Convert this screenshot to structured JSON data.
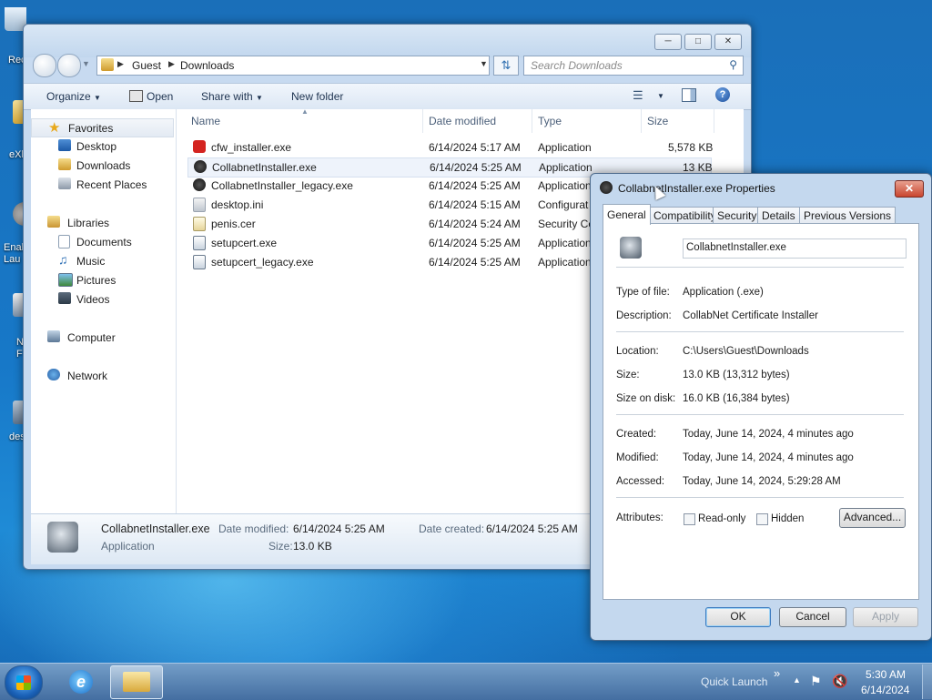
{
  "desktop": {
    "icons": [
      "Rec",
      "eXl",
      "Enal\nLau",
      "N\nF",
      "des"
    ]
  },
  "explorer": {
    "breadcrumb": [
      "Guest",
      "Downloads"
    ],
    "search_placeholder": "Search Downloads",
    "toolbar": {
      "organize": "Organize",
      "open": "Open",
      "share_with": "Share with",
      "new_folder": "New folder"
    },
    "nav": {
      "favorites": "Favorites",
      "favorites_items": [
        "Desktop",
        "Downloads",
        "Recent Places"
      ],
      "libraries": "Libraries",
      "libraries_items": [
        "Documents",
        "Music",
        "Pictures",
        "Videos"
      ],
      "computer": "Computer",
      "network": "Network"
    },
    "columns": [
      "Name",
      "Date modified",
      "Type",
      "Size"
    ],
    "files": [
      {
        "name": "cfw_installer.exe",
        "date": "6/14/2024 5:17 AM",
        "type": "Application",
        "size": "5,578 KB"
      },
      {
        "name": "CollabnetInstaller.exe",
        "date": "6/14/2024 5:25 AM",
        "type": "Application",
        "size": "13 KB"
      },
      {
        "name": "CollabnetInstaller_legacy.exe",
        "date": "6/14/2024 5:25 AM",
        "type": "Application",
        "size": ""
      },
      {
        "name": "desktop.ini",
        "date": "6/14/2024 5:15 AM",
        "type": "Configurat",
        "size": ""
      },
      {
        "name": "penis.cer",
        "date": "6/14/2024 5:24 AM",
        "type": "Security Ce",
        "size": ""
      },
      {
        "name": "setupcert.exe",
        "date": "6/14/2024 5:25 AM",
        "type": "Application",
        "size": ""
      },
      {
        "name": "setupcert_legacy.exe",
        "date": "6/14/2024 5:25 AM",
        "type": "Application",
        "size": ""
      }
    ],
    "details": {
      "name": "CollabnetInstaller.exe",
      "type": "Application",
      "date_modified_label": "Date modified:",
      "date_modified": "6/14/2024 5:25 AM",
      "size_label": "Size:",
      "size": "13.0 KB",
      "date_created_label": "Date created:",
      "date_created": "6/14/2024 5:25 AM"
    }
  },
  "properties": {
    "title": "CollabnetInstaller.exe Properties",
    "tabs": [
      "General",
      "Compatibility",
      "Security",
      "Details",
      "Previous Versions"
    ],
    "filename": "CollabnetInstaller.exe",
    "fields": {
      "type_label": "Type of file:",
      "type": "Application (.exe)",
      "desc_label": "Description:",
      "desc": "CollabNet Certificate Installer",
      "location_label": "Location:",
      "location": "C:\\Users\\Guest\\Downloads",
      "size_label": "Size:",
      "size": "13.0 KB (13,312 bytes)",
      "disk_label": "Size on disk:",
      "disk": "16.0 KB (16,384 bytes)",
      "created_label": "Created:",
      "created": "Today, June 14, 2024, 4 minutes ago",
      "modified_label": "Modified:",
      "modified": "Today, June 14, 2024, 4 minutes ago",
      "accessed_label": "Accessed:",
      "accessed": "Today, June 14, 2024, 5:29:28 AM",
      "attributes_label": "Attributes:",
      "readonly": "Read-only",
      "hidden": "Hidden",
      "advanced": "Advanced..."
    },
    "buttons": {
      "ok": "OK",
      "cancel": "Cancel",
      "apply": "Apply"
    }
  },
  "taskbar": {
    "quick_launch": "Quick Launch",
    "chevron": "»",
    "time": "5:30 AM",
    "date": "6/14/2024"
  }
}
